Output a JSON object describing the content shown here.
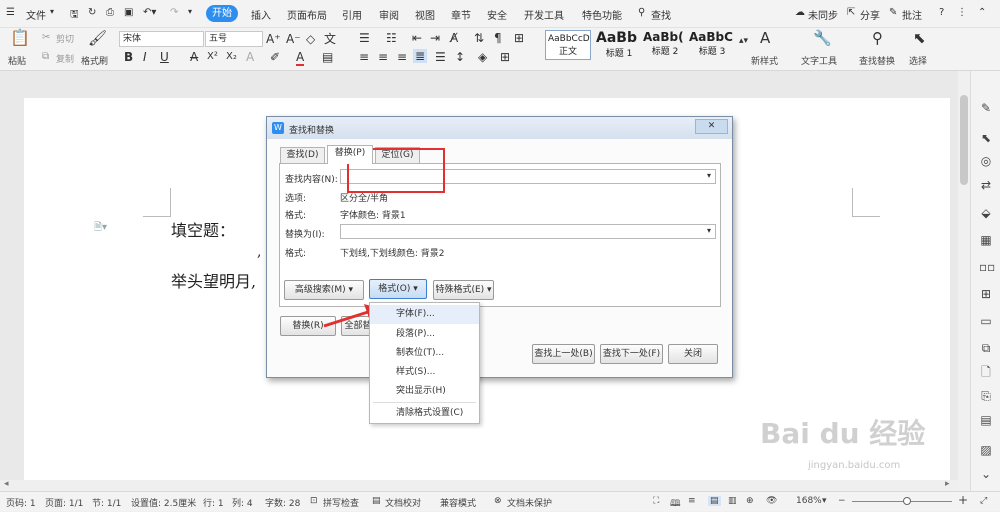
{
  "menubar": {
    "file": "文件",
    "tabs": [
      "开始",
      "插入",
      "页面布局",
      "引用",
      "审阅",
      "视图",
      "章节",
      "安全",
      "开发工具",
      "特色功能"
    ],
    "search": "查找",
    "sync": "未同步",
    "share": "分享",
    "comment": "批注",
    "help": "?"
  },
  "ribbon": {
    "paste": "粘贴",
    "cut": "剪切",
    "copy": "复制",
    "format_painter": "格式刷",
    "font_name": "宋体",
    "font_size": "五号",
    "styles": [
      {
        "preview": "AaBbCcDd",
        "label": "正文"
      },
      {
        "preview": "AaBb",
        "label": "标题 1"
      },
      {
        "preview": "AaBb(",
        "label": "标题 2"
      },
      {
        "preview": "AaBbC",
        "label": "标题 3"
      }
    ],
    "new_style": "新样式",
    "text_tool": "文字工具",
    "find_replace": "查找替换",
    "select": "选择"
  },
  "document": {
    "line1": "填空题：",
    "line2": "举头望明月,",
    "comma": ","
  },
  "dialog": {
    "title": "查找和替换",
    "tabs": [
      "查找(D)",
      "替换(P)",
      "定位(G)"
    ],
    "find_label": "查找内容(N):",
    "options_label": "选项:",
    "options_value": "区分全/半角",
    "format_label": "格式:",
    "format_value": "字体颜色: 背景1",
    "replace_label": "替换为(I):",
    "format2_label": "格式:",
    "format2_value": "下划线,下划线颜色: 背景2",
    "btn_advanced": "高级搜索(M) ▾",
    "btn_format": "格式(O) ▾",
    "btn_special": "特殊格式(E) ▾",
    "btn_replace": "替换(R)",
    "btn_replace_all": "全部替",
    "btn_prev": "查找上一处(B)",
    "btn_next": "查找下一处(F)",
    "btn_close": "关闭"
  },
  "dropdown": {
    "items": [
      "字体(F)...",
      "段落(P)...",
      "制表位(T)...",
      "样式(S)...",
      "突出显示(H)",
      "清除格式设置(C)"
    ]
  },
  "status": {
    "page_num": "页码: 1",
    "pages": "页面: 1/1",
    "section": "节: 1/1",
    "setting": "设置值: 2.5厘米",
    "row": "行: 1",
    "col": "列: 4",
    "words": "字数: 28",
    "spell": "拼写检查",
    "proof": "文档校对",
    "compat": "兼容模式",
    "unprotected": "文档未保护",
    "zoom": "168%"
  },
  "watermark": {
    "brand": "Bai du 经验",
    "url": "jingyan.baidu.com"
  },
  "colors": {
    "accent": "#2d8ef0",
    "highlight_red": "#e03030",
    "window_border": "#7a8ea8"
  }
}
